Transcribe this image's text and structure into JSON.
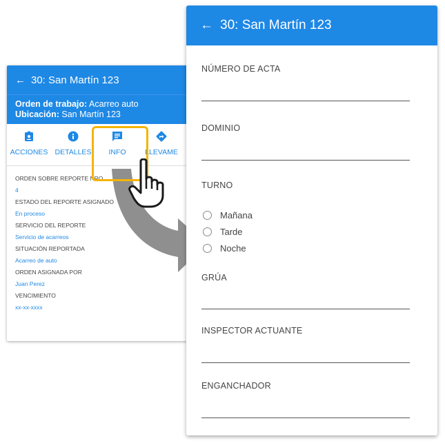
{
  "back_card": {
    "title": "30: San Martín 123",
    "order_label": "Orden  de trabajo:",
    "order_value": "Acarreo auto",
    "location_label": "Ubicación:",
    "location_value": "San Martín 123",
    "tabs": [
      {
        "label": "ACCIONES",
        "icon": "badge-icon"
      },
      {
        "label": "DETALLES",
        "icon": "info-icon"
      },
      {
        "label": "INFO",
        "icon": "message-icon"
      },
      {
        "label": "LLEVAME",
        "icon": "directions-icon"
      }
    ],
    "info": [
      {
        "label": "ORDEN SOBRE REPORTE NRO",
        "value": "4"
      },
      {
        "label": "ESTADO DEL REPORTE ASIGNADO",
        "value": "En proceso"
      },
      {
        "label": "SERVICIO DEL REPORTE",
        "value": "Servicio de acarreos"
      },
      {
        "label": "SITUACIÓN REPORTADA",
        "value": "Acarreo de auto"
      },
      {
        "label": "ORDEN ASIGNADA POR",
        "value": "Juan Perez"
      },
      {
        "label": "VENCIMIENTO",
        "value": "xx-xx-xxxx"
      }
    ]
  },
  "front_card": {
    "title": "30: San Martín 123",
    "fields": {
      "numero_acta": "NÚMERO DE ACTA",
      "dominio": "DOMINIO",
      "turno": "TURNO",
      "grua": "GRÚA",
      "inspector": "INSPECTOR ACTUANTE",
      "enganchador": "ENGANCHADOR"
    },
    "turno_options": [
      "Mañana",
      "Tarde",
      "Noche"
    ]
  },
  "colors": {
    "primary": "#1e88e5",
    "highlight": "#f5b400"
  }
}
